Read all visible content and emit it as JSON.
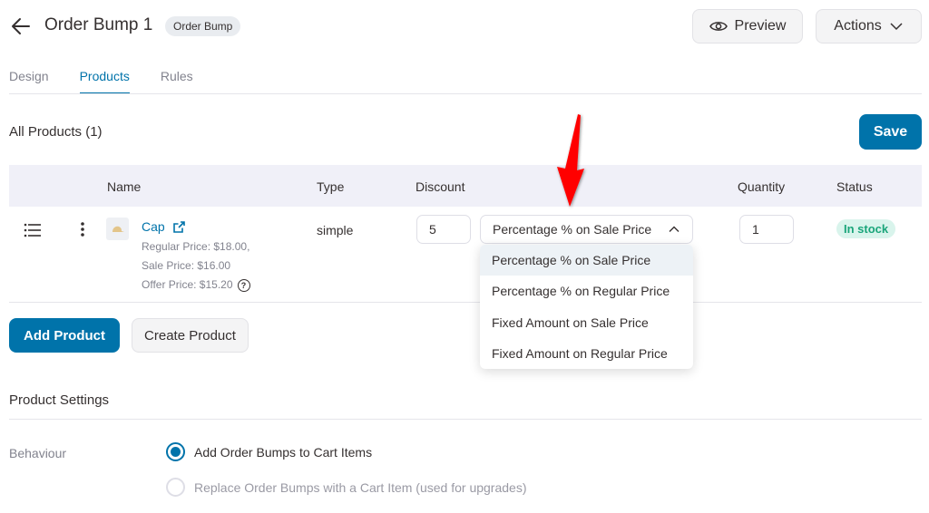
{
  "header": {
    "title": "Order Bump 1",
    "badge": "Order Bump",
    "preview_label": "Preview",
    "actions_label": "Actions"
  },
  "tabs": [
    {
      "label": "Design",
      "active": false
    },
    {
      "label": "Products",
      "active": true
    },
    {
      "label": "Rules",
      "active": false
    }
  ],
  "products": {
    "section_title": "All Products (1)",
    "save_label": "Save",
    "columns": [
      "Name",
      "Type",
      "Discount",
      "Quantity",
      "Status"
    ],
    "rows": [
      {
        "name": "Cap",
        "regular_price": "Regular Price: $18.00,",
        "sale_price": "Sale Price: $16.00",
        "offer_price": "Offer Price: $15.20",
        "type": "simple",
        "discount_value": "5",
        "discount_type": "Percentage % on Sale Price",
        "quantity": "1",
        "status": "In stock"
      }
    ],
    "discount_options": [
      "Percentage % on Sale Price",
      "Percentage % on Regular Price",
      "Fixed Amount on Sale Price",
      "Fixed Amount on Regular Price"
    ],
    "add_product_label": "Add Product",
    "create_product_label": "Create Product"
  },
  "settings": {
    "title": "Product Settings",
    "behaviour_label": "Behaviour",
    "options": [
      {
        "label": "Add Order Bumps to Cart Items",
        "checked": true
      },
      {
        "label": "Replace Order Bumps with a Cart Item (used for upgrades)",
        "checked": false
      }
    ]
  },
  "colors": {
    "accent": "#0073aa",
    "status_green": "#1aa57a",
    "annotation_red": "#ff0000"
  }
}
